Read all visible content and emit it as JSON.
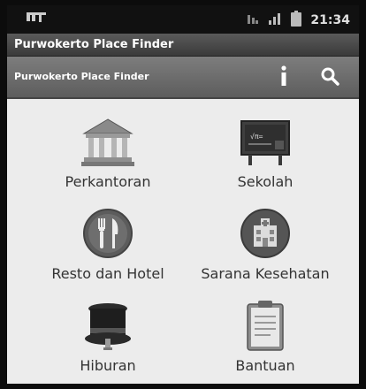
{
  "status_bar": {
    "time": "21:34",
    "icons": [
      "signal-icon",
      "network-icon",
      "signal-bars-icon",
      "battery-icon"
    ]
  },
  "title_bar": {
    "title": "Purwokerto Place Finder"
  },
  "action_bar": {
    "title": "Purwokerto Place Finder",
    "info_icon": "info-icon",
    "search_icon": "search-icon"
  },
  "menu": [
    {
      "label": "Perkantoran",
      "icon": "government-building-icon"
    },
    {
      "label": "Sekolah",
      "icon": "chalkboard-icon"
    },
    {
      "label": "Resto dan Hotel",
      "icon": "fork-knife-icon"
    },
    {
      "label": "Sarana Kesehatan",
      "icon": "hospital-icon"
    },
    {
      "label": "Hiburan",
      "icon": "top-hat-icon"
    },
    {
      "label": "Bantuan",
      "icon": "clipboard-icon"
    }
  ],
  "colors": {
    "status_bar": "#111111",
    "title_bar": "#4a4a4a",
    "action_bar": "#6d6d6d",
    "content_bg": "#ececec",
    "label_text": "#333333"
  }
}
